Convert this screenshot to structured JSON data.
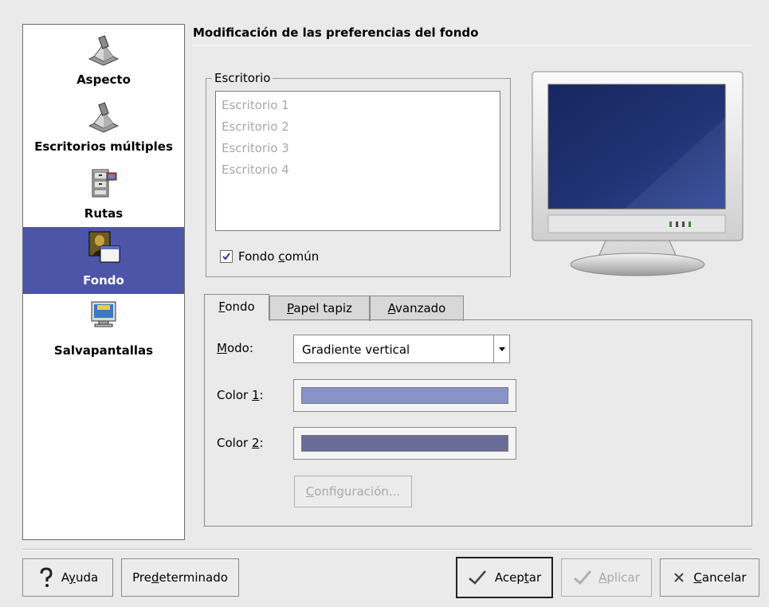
{
  "page_title": "Modificación de las preferencias del fondo",
  "sidebar": {
    "items": [
      {
        "label": "Aspecto",
        "icon": "appearance-icon"
      },
      {
        "label": "Escritorios múltiples",
        "icon": "workspaces-icon"
      },
      {
        "label": "Rutas",
        "icon": "paths-icon"
      },
      {
        "label": "Fondo",
        "icon": "background-icon",
        "selected": true
      },
      {
        "label": "Salvapantallas",
        "icon": "screensaver-icon"
      }
    ]
  },
  "desktop_group": {
    "legend": "Escritorio",
    "desktops": [
      "Escritorio 1",
      "Escritorio 2",
      "Escritorio 3",
      "Escritorio 4"
    ],
    "common_bg": {
      "pre": "Fondo ",
      "mn": "c",
      "post": "omún",
      "checked": true
    }
  },
  "tabs": [
    {
      "mn": "F",
      "post": "ondo",
      "active": true
    },
    {
      "mn": "P",
      "post": "apel tapiz",
      "active": false
    },
    {
      "mn": "A",
      "post": "vanzado",
      "active": false
    }
  ],
  "fondo_tab": {
    "mode_label": {
      "mn": "M",
      "post": "odo:"
    },
    "mode_value": "Gradiente vertical",
    "color1_label": {
      "pre": "Color ",
      "mn": "1",
      "post": ":"
    },
    "color1_value": "#8a93c8",
    "color2_label": {
      "pre": "Color ",
      "mn": "2",
      "post": ":"
    },
    "color2_value": "#6a6c98",
    "config_button": {
      "mn": "C",
      "post": "onfiguración..."
    }
  },
  "buttons": {
    "help": {
      "pre": "A",
      "mn": "y",
      "post": "uda"
    },
    "defaults": {
      "pre": "Pre",
      "mn": "d",
      "post": "eterminado"
    },
    "ok": {
      "pre": "Acep",
      "mn": "t",
      "post": "ar"
    },
    "apply": {
      "mn": "A",
      "post": "plicar"
    },
    "cancel": {
      "mn": "C",
      "post": "ancelar"
    }
  },
  "preview": {
    "screen_gradient_top": "#1c2c68",
    "screen_gradient_bottom": "#2a3f88"
  }
}
